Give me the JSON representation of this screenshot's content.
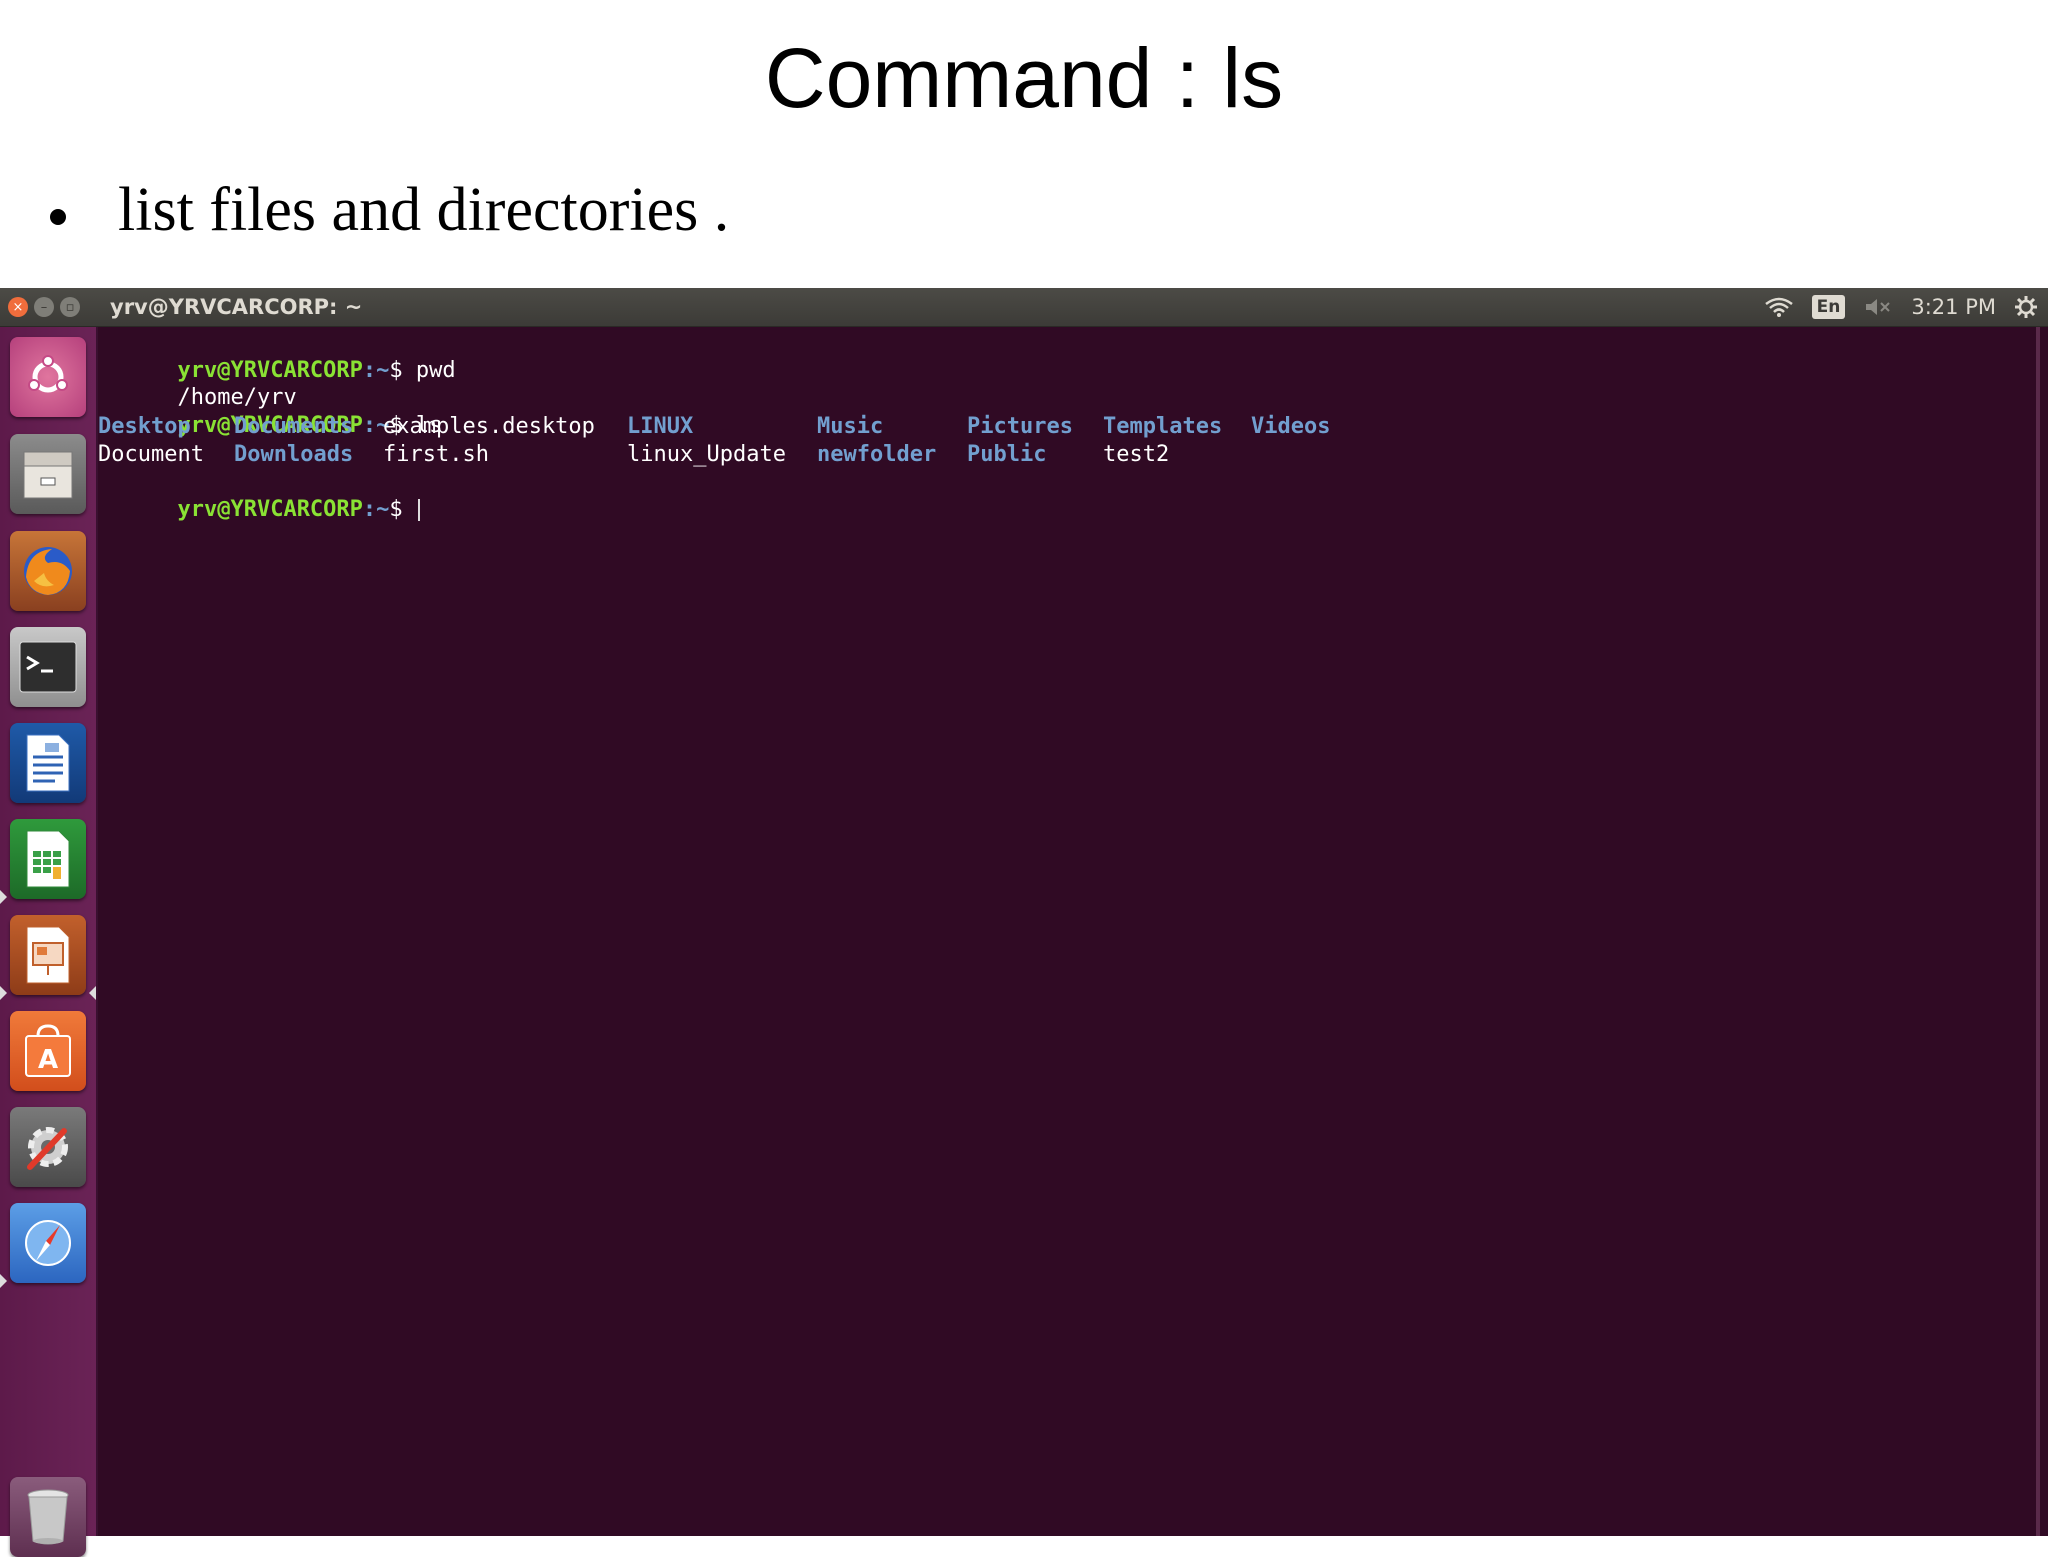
{
  "slide": {
    "title": "Command : ls",
    "bullet": "list files and directories ."
  },
  "window": {
    "title": "yrv@YRVCARCORP: ~",
    "close_glyph": "×",
    "min_glyph": "–",
    "max_glyph": "▫"
  },
  "tray": {
    "wifi_icon": "wifi-icon",
    "keyboard_layout": "En",
    "volume_icon": "volume-muted-icon",
    "time": "3:21 PM",
    "settings_icon": "gear-icon"
  },
  "launcher": {
    "items": [
      {
        "name": "ubuntu-dash-icon"
      },
      {
        "name": "files-icon"
      },
      {
        "name": "firefox-icon"
      },
      {
        "name": "terminal-icon"
      },
      {
        "name": "writer-icon"
      },
      {
        "name": "calc-icon"
      },
      {
        "name": "impress-icon"
      },
      {
        "name": "software-center-icon"
      },
      {
        "name": "system-settings-icon"
      },
      {
        "name": "compass-icon"
      },
      {
        "name": "trash-icon"
      }
    ]
  },
  "terminal": {
    "prompt_user": "yrv@YRVCARCORP",
    "prompt_path": ":~",
    "prompt_symbol": "$",
    "lines": {
      "cmd1": " pwd",
      "out1": "/home/yrv",
      "cmd2": " ls",
      "cmd3": ""
    },
    "ls_row1": [
      "Desktop",
      "Documents",
      "examples.desktop",
      "LINUX",
      "Music",
      "Pictures",
      "Templates",
      "Videos"
    ],
    "ls_row2": [
      "Document",
      "Downloads",
      "first.sh",
      "linux_Update",
      "newfolder",
      "Public",
      "test2"
    ]
  },
  "colors": {
    "terminal_bg": "#300a24",
    "prompt_user": "#8ae234",
    "directory": "#729fcf",
    "launcher_bg": "#5d1a4a"
  }
}
